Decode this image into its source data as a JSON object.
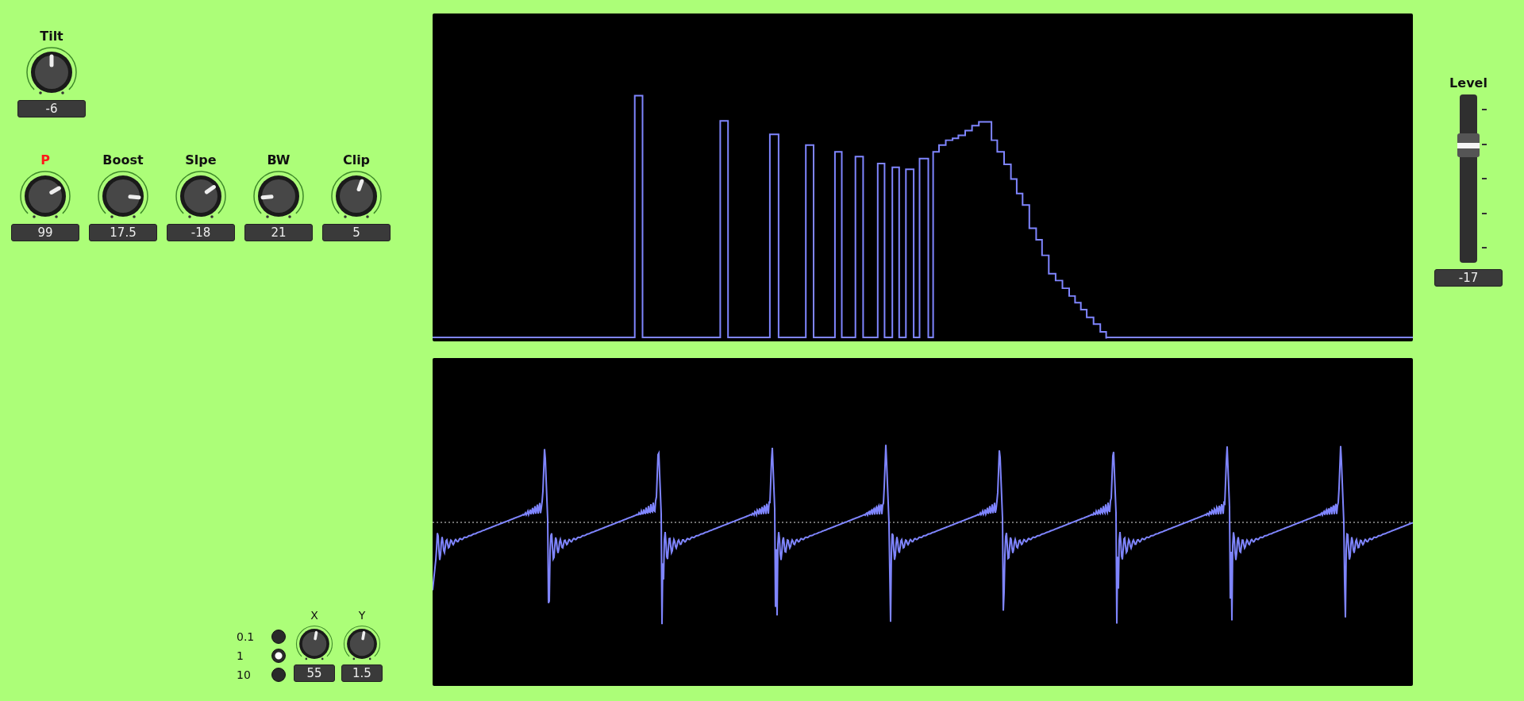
{
  "tilt": {
    "label": "Tilt",
    "value": "-6"
  },
  "knobs": [
    {
      "label": "P",
      "value": "99",
      "highlighted": true
    },
    {
      "label": "Boost",
      "value": "17.5",
      "highlighted": false
    },
    {
      "label": "Slpe",
      "value": "-18",
      "highlighted": false
    },
    {
      "label": "BW",
      "value": "21",
      "highlighted": false
    },
    {
      "label": "Clip",
      "value": "5",
      "highlighted": false
    }
  ],
  "scale": [
    {
      "label": "0.1",
      "selected": false
    },
    {
      "label": "1",
      "selected": true
    },
    {
      "label": "10",
      "selected": false
    }
  ],
  "xy": [
    {
      "label": "X",
      "value": "55"
    },
    {
      "label": "Y",
      "value": "1.5"
    }
  ],
  "fader": {
    "label": "Level",
    "value": "-17",
    "level": 0.7
  }
}
